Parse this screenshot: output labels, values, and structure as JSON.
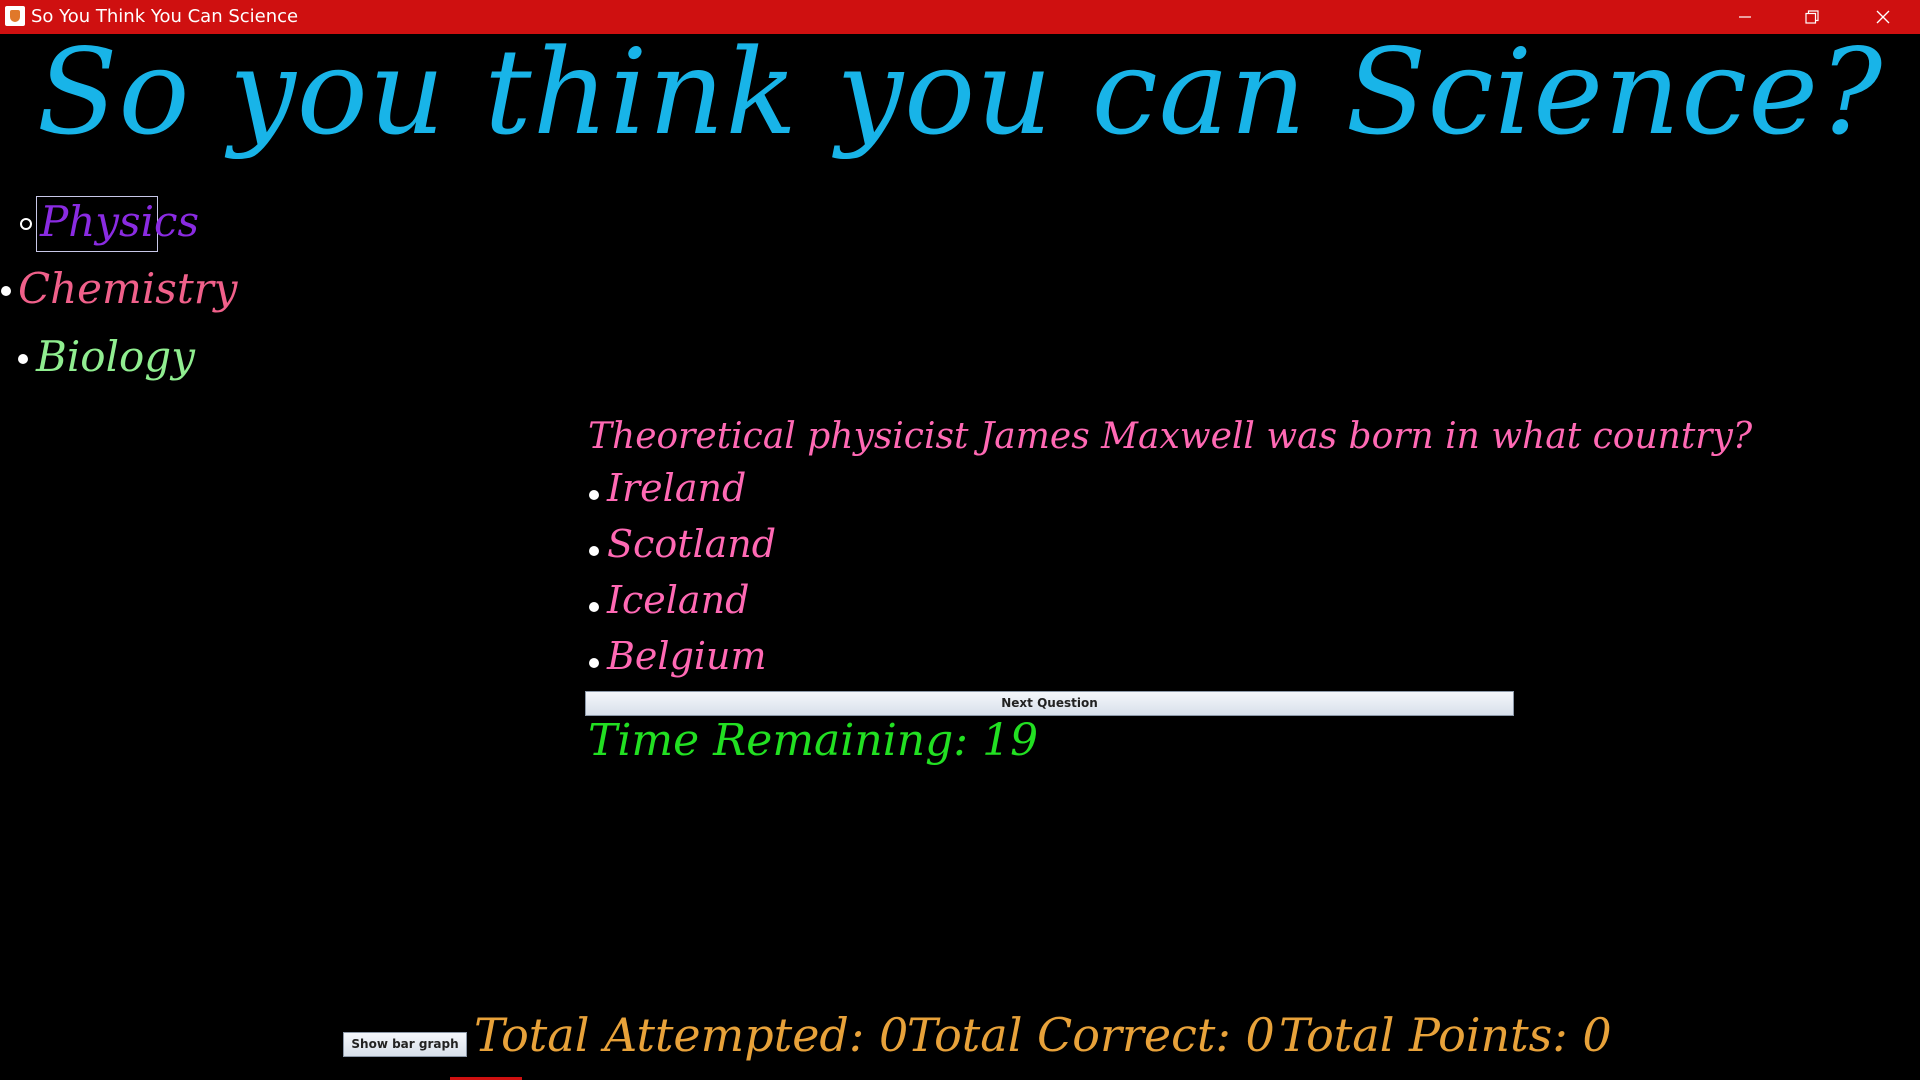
{
  "window": {
    "title": "So You Think You Can Science",
    "accent_color": "#cf1010"
  },
  "heading": "So you think you can Science?",
  "categories": [
    {
      "label": "Physics",
      "selected": true,
      "color": "#8a2be2"
    },
    {
      "label": "Chemistry",
      "selected": false,
      "color": "#f0608a"
    },
    {
      "label": "Biology",
      "selected": false,
      "color": "#90ee90"
    }
  ],
  "quiz": {
    "question": "Theoretical physicist James Maxwell was born in what country?",
    "answers": [
      "Ireland",
      "Scotland",
      "Iceland",
      "Belgium"
    ],
    "next_label": "Next Question",
    "timer": "Time Remaining: 19"
  },
  "footer": {
    "bar_graph_label": "Show bar graph",
    "attempted": "Total Attempted:  0",
    "correct": "Total Correct:  0",
    "points": "Total Points:  0"
  }
}
